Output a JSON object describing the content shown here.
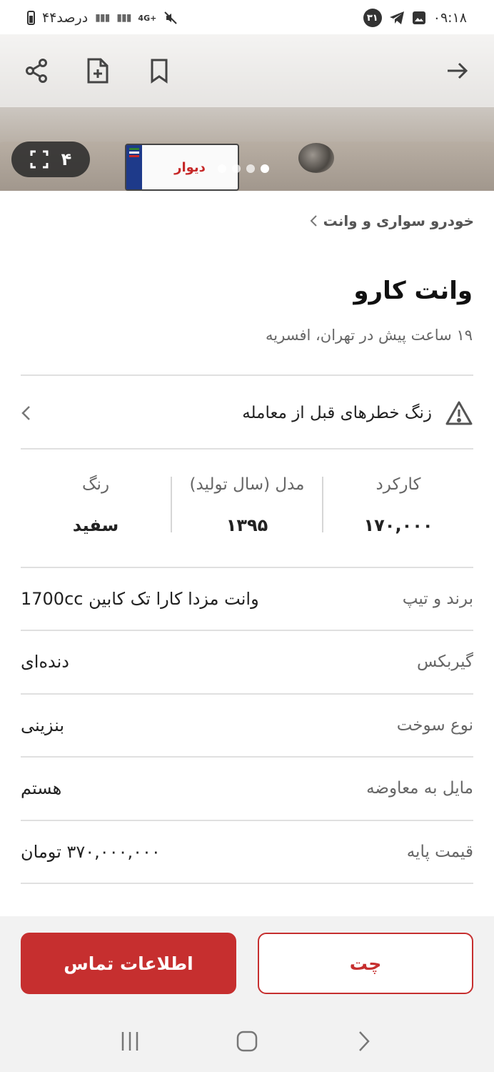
{
  "status_bar": {
    "time": "۰۹:۱۸",
    "battery_text": "۴۴درصد",
    "network": "4G+",
    "notification_count": "۳۱"
  },
  "hero": {
    "photo_count": "۴",
    "plate_text": "دیوار",
    "total_slides": 4,
    "active_slide": 1
  },
  "breadcrumb": {
    "label": "خودرو سواری و وانت"
  },
  "ad": {
    "title": "وانت کارو",
    "subtitle": "۱۹ ساعت پیش در تهران، افسریه"
  },
  "warning": {
    "label": "زنگ خطرهای قبل از معامله"
  },
  "stats": [
    {
      "label": "کارکرد",
      "value": "۱۷۰,۰۰۰"
    },
    {
      "label": "مدل (سال تولید)",
      "value": "۱۳۹۵"
    },
    {
      "label": "رنگ",
      "value": "سفید"
    }
  ],
  "specs": [
    {
      "label": "برند و تیپ",
      "value": "وانت مزدا کارا تک کابین 1700cc"
    },
    {
      "label": "گیربکس",
      "value": "دنده‌ای"
    },
    {
      "label": "نوع سوخت",
      "value": "بنزینی"
    },
    {
      "label": "مایل به معاوضه",
      "value": "هستم"
    },
    {
      "label": "قیمت پایه",
      "value": "۳۷۰,۰۰۰,۰۰۰ تومان"
    }
  ],
  "actions": {
    "contact_label": "اطلاعات تماس",
    "chat_label": "چت"
  },
  "colors": {
    "accent": "#c62f2f",
    "background": "#ffffff",
    "divider": "#e0e0e0"
  }
}
